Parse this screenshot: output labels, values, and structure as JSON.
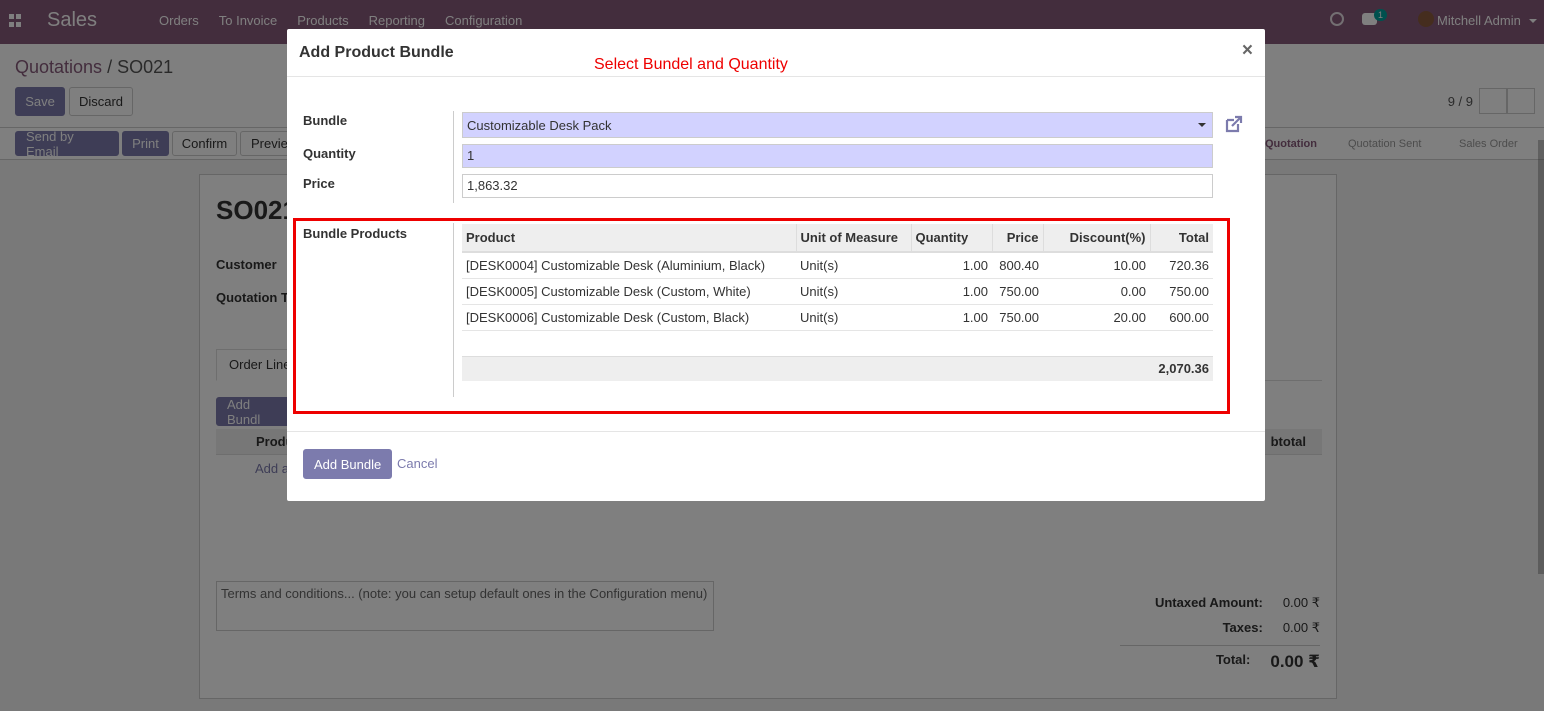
{
  "app": {
    "brand": "Sales",
    "menu": [
      "Orders",
      "To Invoice",
      "Products",
      "Reporting",
      "Configuration"
    ],
    "chat_badge": "1",
    "user": "Mitchell Admin"
  },
  "control_panel": {
    "breadcrumb_parent": "Quotations",
    "breadcrumb_sep": " / ",
    "breadcrumb_current": "SO021",
    "save_label": "Save",
    "discard_label": "Discard",
    "pager": "9 / 9"
  },
  "statusbar": {
    "buttons": [
      "Send by Email",
      "Print",
      "Confirm",
      "Previe"
    ],
    "stages": [
      "Quotation",
      "Quotation Sent",
      "Sales Order"
    ]
  },
  "sheet": {
    "title": "SO021",
    "customer_label": "Customer",
    "quotation_template_label": "Quotation T",
    "tab_order_lines": "Order Line",
    "add_bundle": "Add Bundl",
    "col_product": "Produ",
    "col_subtotal": "btotal",
    "add_line": "Add a",
    "terms_placeholder": "Terms and conditions... (note: you can setup default ones in the Configuration menu)",
    "untaxed_label": "Untaxed Amount:",
    "untaxed_value": "0.00 ₹",
    "taxes_label": "Taxes:",
    "taxes_value": "0.00 ₹",
    "total_label": "Total:",
    "total_value": "0.00 ₹"
  },
  "modal": {
    "title": "Add Product Bundle",
    "annotation": "Select Bundel and Quantity",
    "close": "×",
    "bundle_label": "Bundle",
    "bundle_value": "Customizable Desk Pack",
    "quantity_label": "Quantity",
    "quantity_value": "1",
    "price_label": "Price",
    "price_value": "1,863.32",
    "bundle_products_label": "Bundle Products",
    "table": {
      "headers": [
        "Product",
        "Unit of Measure",
        "Quantity",
        "Price",
        "Discount(%)",
        "Total"
      ],
      "rows": [
        [
          "[DESK0004] Customizable Desk (Aluminium, Black)",
          "Unit(s)",
          "1.00",
          "800.40",
          "10.00",
          "720.36"
        ],
        [
          "[DESK0005] Customizable Desk (Custom, White)",
          "Unit(s)",
          "1.00",
          "750.00",
          "0.00",
          "750.00"
        ],
        [
          "[DESK0006] Customizable Desk (Custom, Black)",
          "Unit(s)",
          "1.00",
          "750.00",
          "20.00",
          "600.00"
        ]
      ],
      "footer_total": "2,070.36"
    },
    "add_bundle_button": "Add Bundle",
    "cancel_button": "Cancel"
  },
  "colors": {
    "brand": "#875a7b",
    "primary_button": "#7c7bad",
    "required_field": "#d2d2ff",
    "annotation": "#ee0000"
  }
}
